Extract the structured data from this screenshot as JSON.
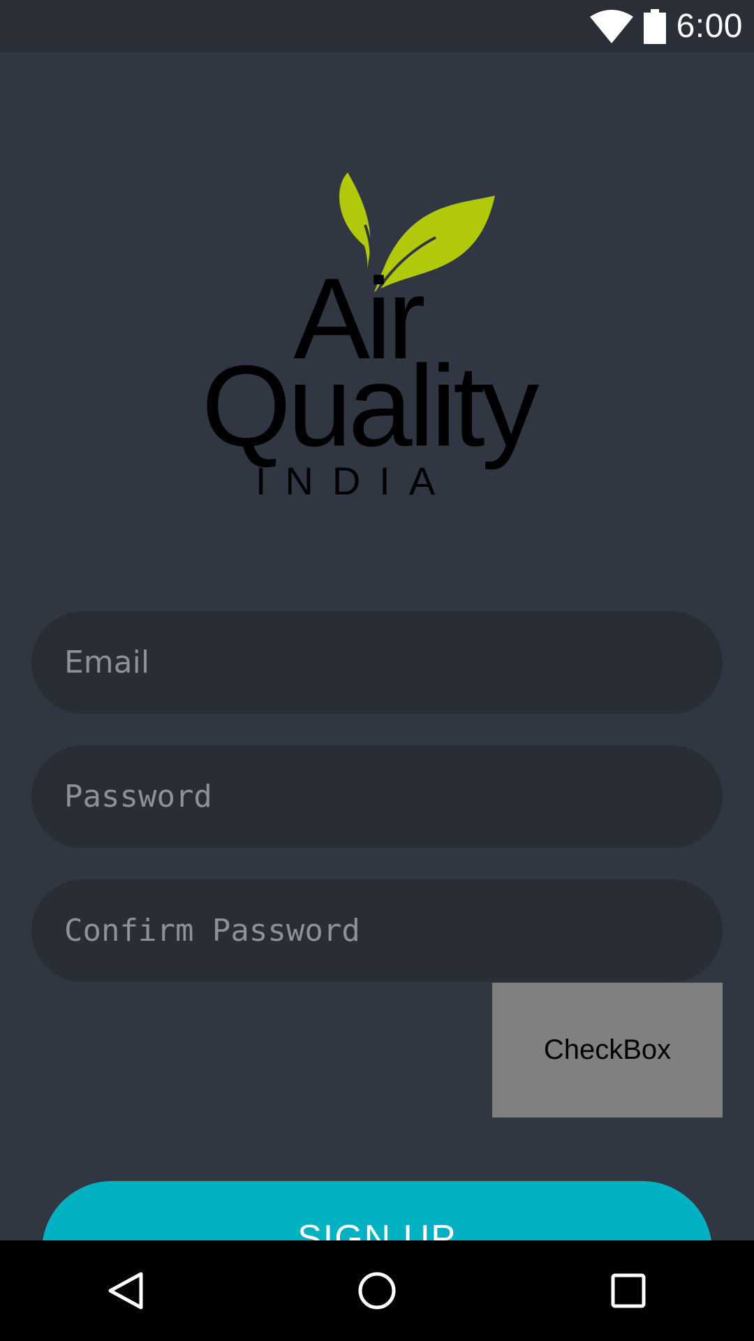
{
  "status_bar": {
    "time": "6:00",
    "icons": [
      "wifi-icon",
      "battery-icon"
    ]
  },
  "logo": {
    "line1": "Air",
    "line2": "Quality",
    "line3": "INDIA",
    "leaf_color": "#b2c80a"
  },
  "form": {
    "email_placeholder": "Email",
    "password_placeholder": "Password",
    "confirm_placeholder": "Confirm Password",
    "checkbox_label": "CheckBox",
    "signup_label": "SIGN UP"
  },
  "nav_bar": {
    "icons": [
      "back-icon",
      "home-icon",
      "recents-icon"
    ]
  },
  "colors": {
    "background": "#313742",
    "field": "#292e35",
    "accent": "#00b1c1",
    "checkbox": "#808080"
  }
}
